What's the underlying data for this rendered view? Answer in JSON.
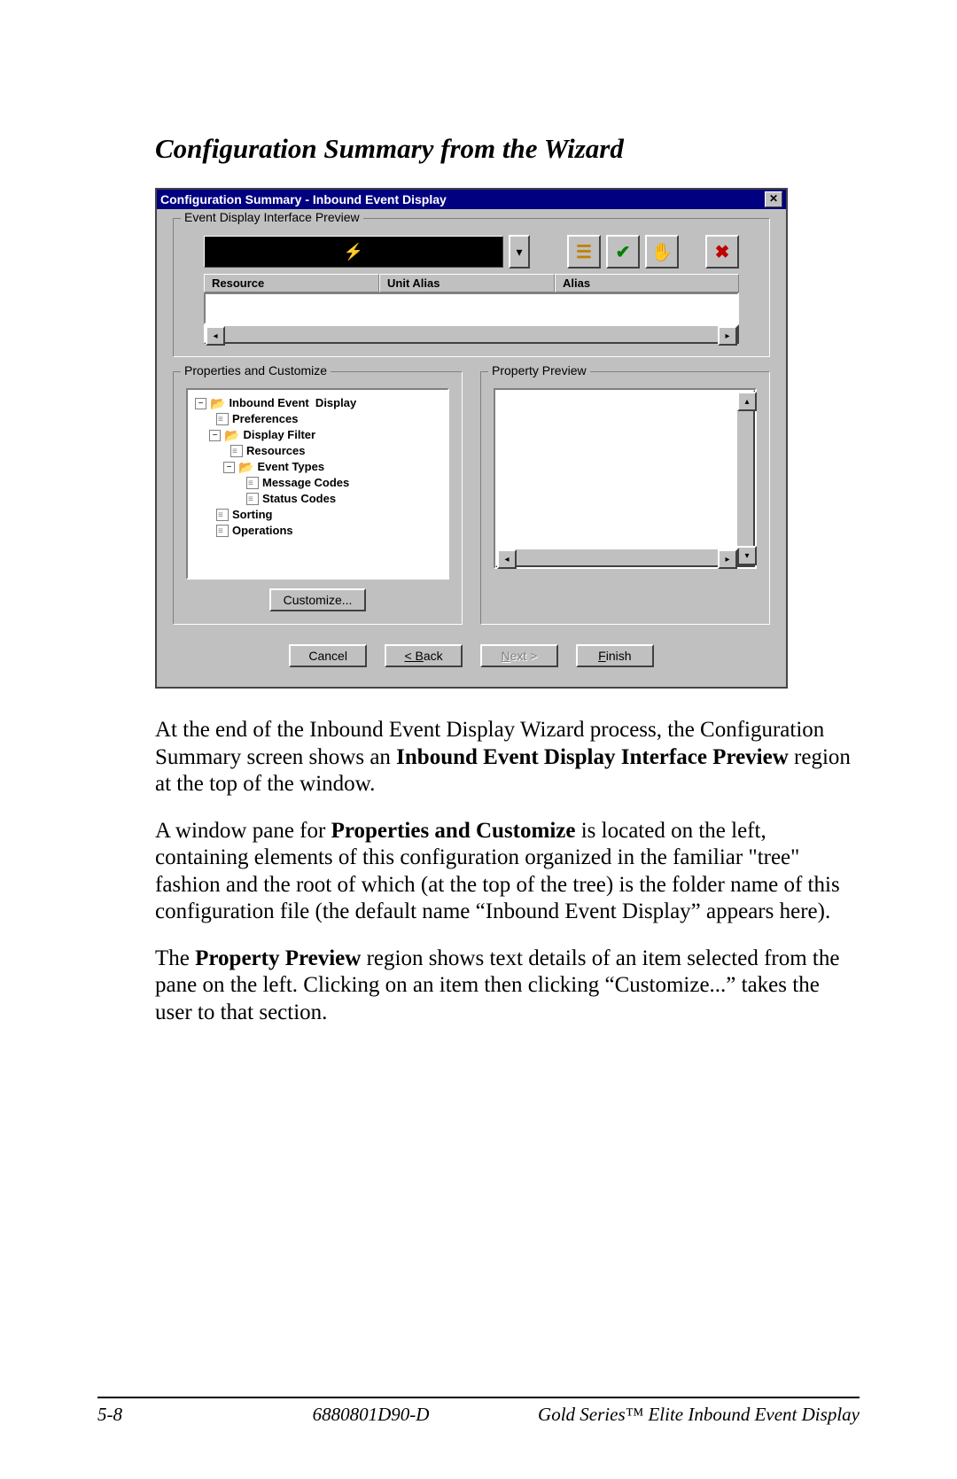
{
  "heading": "Configuration Summary from the Wizard",
  "dialog": {
    "title": "Configuration Summary - Inbound Event  Display",
    "group_preview": "Event Display Interface Preview",
    "columns": {
      "resource": "Resource",
      "unit_alias": "Unit Alias",
      "alias": "Alias"
    },
    "group_props": "Properties and Customize",
    "group_preview2": "Property Preview",
    "customize": "Customize...",
    "tree": {
      "root": "Inbound Event  Display",
      "prefs": "Preferences",
      "filter": "Display Filter",
      "resources": "Resources",
      "event_types": "Event Types",
      "message_codes": "Message Codes",
      "status_codes": "Status Codes",
      "sorting": "Sorting",
      "operations": "Operations"
    },
    "buttons": {
      "cancel": "Cancel",
      "back": "< Back",
      "next": "Next >",
      "finish": "Finish"
    }
  },
  "para1_a": "At the end of the Inbound Event Display Wizard process, the Configuration Summary screen shows an ",
  "para1_b": "Inbound Event Display Interface Preview",
  "para1_c": " region at the top of the window.",
  "para2_a": "A window pane for ",
  "para2_b": "Properties and Customize",
  "para2_c": " is located on the left, containing elements of this configuration organized in the familiar \"tree\" fashion and the root of which (at the top of the tree) is the folder name of this configuration file (the default name “Inbound Event Display” appears here).",
  "para3_a": "The ",
  "para3_b": "Property Preview",
  "para3_c": " region shows text details of an item selected from the pane on the left.  Clicking on an item then clicking “Customize...” takes the user to that section.",
  "footer": {
    "page": "5-8",
    "docnum": "6880801D90-D",
    "product": "Gold Series™ Elite Inbound Event Display"
  }
}
